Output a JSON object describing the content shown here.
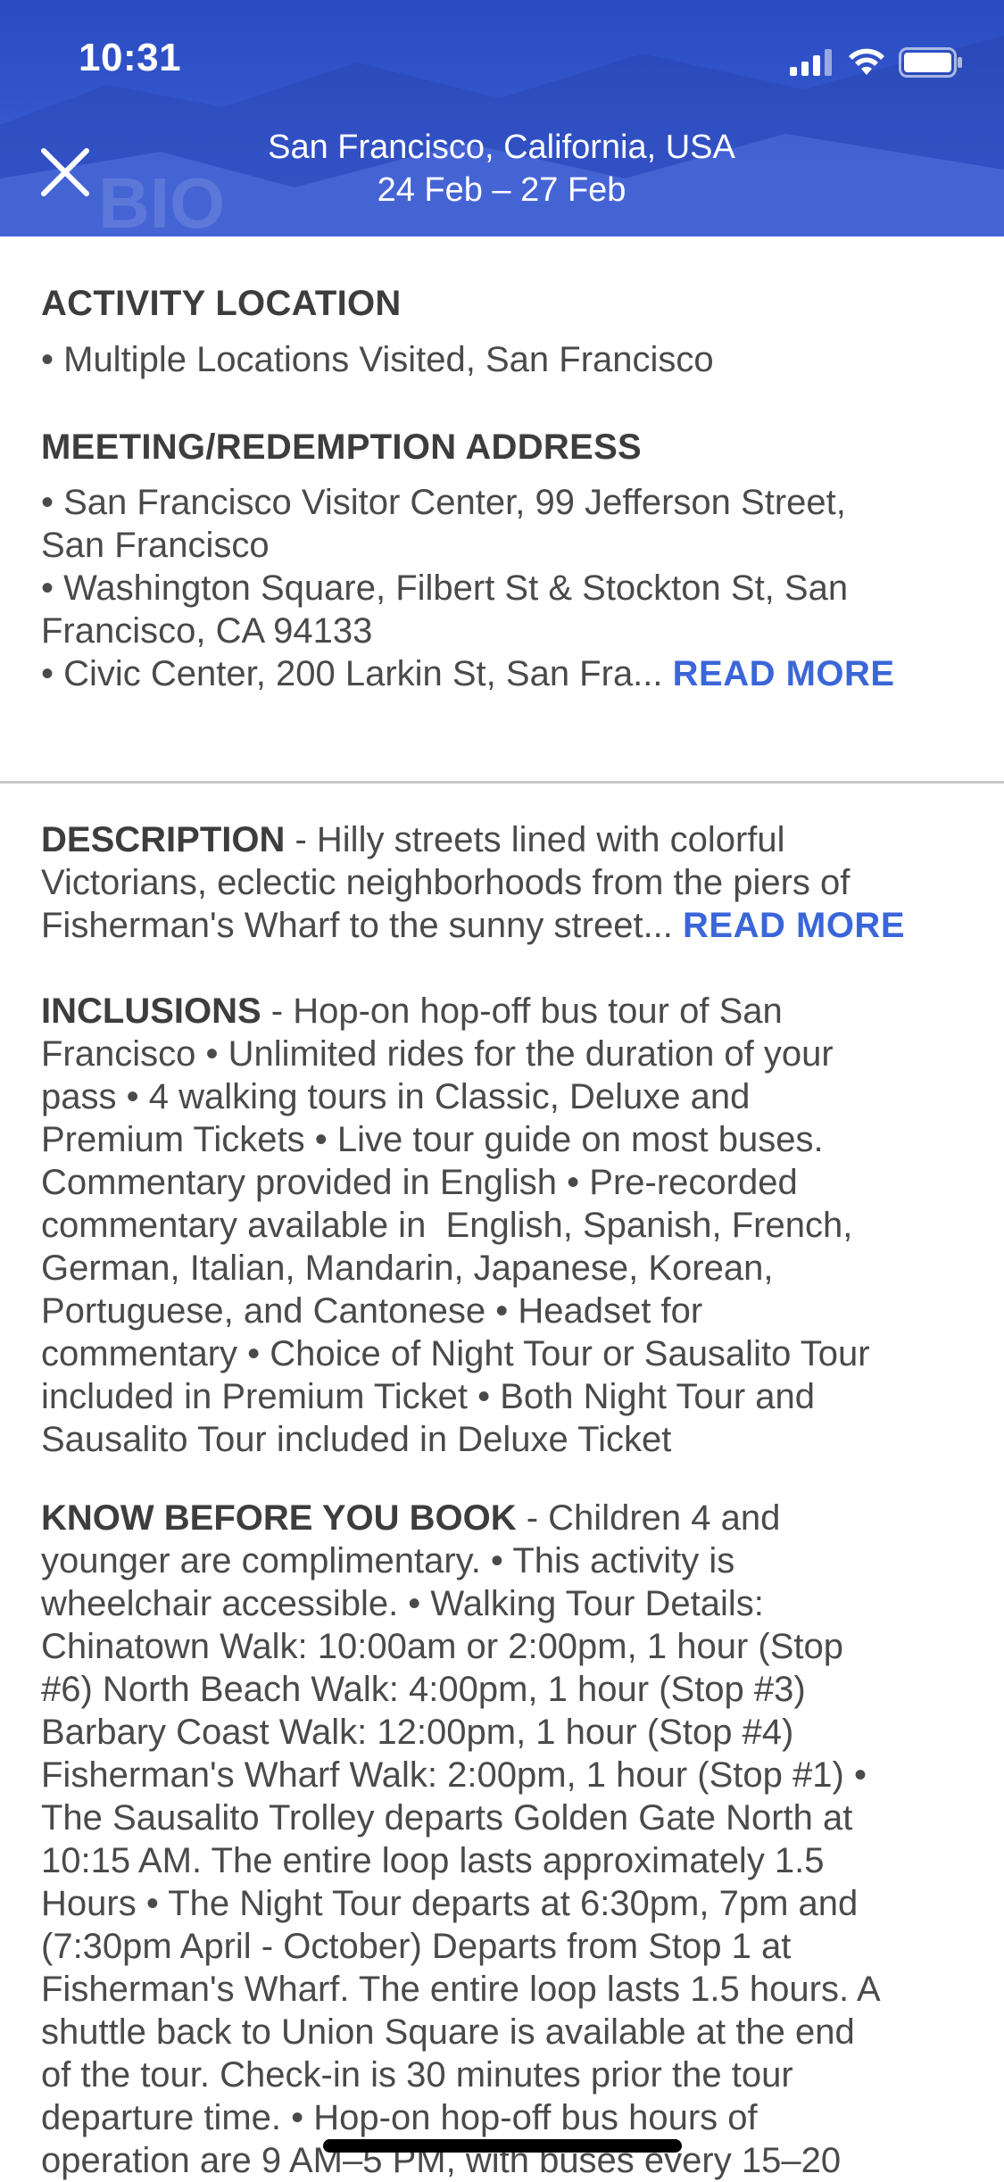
{
  "status_bar": {
    "time": "10:31",
    "icons": [
      "signal-icon",
      "wifi-icon",
      "battery-icon"
    ]
  },
  "header": {
    "location": "San Francisco, California, USA",
    "dates": "24 Feb – 27 Feb",
    "close_icon": "close-icon",
    "accent_color": "#3557cf"
  },
  "activity_location": {
    "label": "ACTIVITY LOCATION",
    "line": " • Multiple Locations Visited, San Francisco"
  },
  "meeting_address": {
    "label": "MEETING/REDEMPTION ADDRESS",
    "lines": [
      " • San Francisco Visitor Center, 99 Jefferson Street,",
      "San Francisco",
      " • Washington Square, Filbert St & Stockton St, San",
      "Francisco, CA 94133",
      " • Civic Center, 200 Larkin St, San Fra..."
    ],
    "read_more": "READ MORE"
  },
  "description": {
    "label": "DESCRIPTION",
    "separator": " - ",
    "lines": [
      "Hilly streets lined with colorful",
      "Victorians, eclectic neighborhoods from the piers of",
      "Fisherman's Wharf to the sunny street..."
    ],
    "read_more": "READ MORE"
  },
  "inclusions": {
    "label": "INCLUSIONS",
    "separator": " - ",
    "lines": [
      "Hop-on hop-off bus tour of San",
      "Francisco • Unlimited rides for the duration of your",
      "pass • 4 walking tours in Classic, Deluxe and",
      "Premium Tickets • Live tour guide on most buses.",
      "Commentary provided in English • Pre-recorded",
      "commentary available in  English, Spanish, French,",
      "German, Italian, Mandarin, Japanese, Korean,",
      "Portuguese, and Cantonese • Headset for",
      "commentary • Choice of Night Tour or Sausalito Tour",
      "included in Premium Ticket • Both Night Tour and",
      "Sausalito Tour included in Deluxe Ticket"
    ]
  },
  "know_before": {
    "label": "KNOW BEFORE YOU BOOK",
    "separator": " - ",
    "lines": [
      "Children 4 and",
      "younger are complimentary. • This activity is",
      "wheelchair accessible. • Walking Tour Details:",
      "Chinatown Walk: 10:00am or 2:00pm, 1 hour (Stop",
      "#6) North Beach Walk: 4:00pm, 1 hour (Stop #3)",
      "Barbary Coast Walk: 12:00pm, 1 hour (Stop #4)",
      "Fisherman's Wharf Walk: 2:00pm, 1 hour (Stop #1) •",
      "The Sausalito Trolley departs Golden Gate North at",
      "10:15 AM. The entire loop lasts approximately 1.5",
      "Hours • The Night Tour departs at 6:30pm, 7pm and",
      "(7:30pm April - October) Departs from Stop 1 at",
      "Fisherman's Wharf. The entire loop lasts 1.5 hours. A",
      "shuttle back to Union Square is available at the end",
      "of the tour. Check-in is 30 minutes prior the tour",
      "departure time. • Hop-on hop-off bus hours of",
      "operation are 9 AM–5 PM, with buses every 15–20"
    ]
  }
}
